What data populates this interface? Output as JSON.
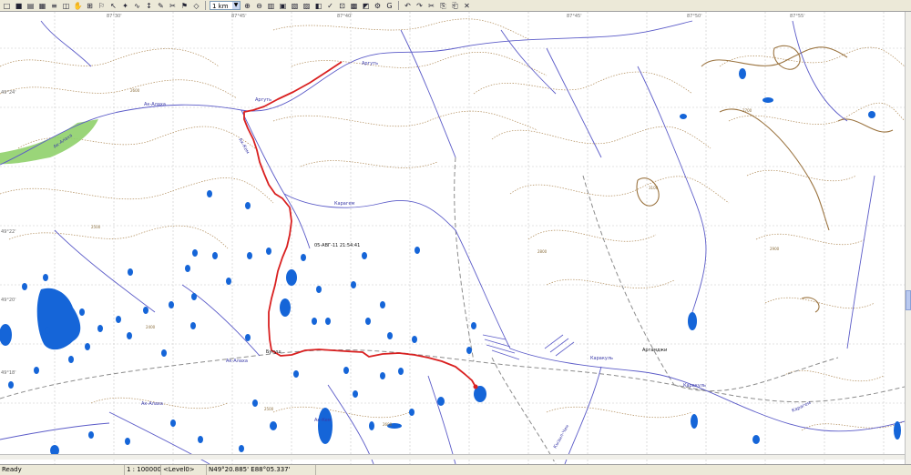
{
  "toolbar": {
    "scale_value": "1 km",
    "buttons": [
      {
        "name": "new-file-icon",
        "glyph": "□"
      },
      {
        "name": "save-icon",
        "glyph": "■"
      },
      {
        "name": "open-icon",
        "glyph": "▤"
      },
      {
        "name": "print-icon",
        "glyph": "▦"
      },
      {
        "name": "track-icon",
        "glyph": "≡"
      },
      {
        "name": "layers-icon",
        "glyph": "◫"
      },
      {
        "name": "hand-pan-icon",
        "glyph": "✋"
      },
      {
        "name": "grid-icon",
        "glyph": "⊞"
      },
      {
        "name": "waypoint-icon",
        "glyph": "⚐"
      },
      {
        "name": "pointer-icon",
        "glyph": "↖"
      },
      {
        "name": "node-icon",
        "glyph": "✦"
      },
      {
        "name": "route-icon",
        "glyph": "∿"
      },
      {
        "name": "measure-icon",
        "glyph": "↕"
      },
      {
        "name": "edit-track-icon",
        "glyph": "✎"
      },
      {
        "name": "split-icon",
        "glyph": "✂"
      },
      {
        "name": "flag-icon",
        "glyph": "⚑"
      },
      {
        "name": "vertex-icon",
        "glyph": "◇"
      }
    ],
    "buttons_after_scale": [
      {
        "name": "zoom-in-icon",
        "glyph": "⊕"
      },
      {
        "name": "zoom-out-icon",
        "glyph": "⊖"
      },
      {
        "name": "map-list-icon",
        "glyph": "▥"
      },
      {
        "name": "map-view-icon",
        "glyph": "▣"
      },
      {
        "name": "map-set-icon",
        "glyph": "▧"
      },
      {
        "name": "satellite-icon",
        "glyph": "▨"
      },
      {
        "name": "overlay-icon",
        "glyph": "◧"
      },
      {
        "name": "check-icon",
        "glyph": "✓"
      },
      {
        "name": "compare-icon",
        "glyph": "⊡"
      },
      {
        "name": "image-icon",
        "glyph": "▩"
      },
      {
        "name": "image-copy-icon",
        "glyph": "◩"
      },
      {
        "name": "settings-icon",
        "glyph": "⚙"
      },
      {
        "name": "google-icon",
        "glyph": "G"
      }
    ],
    "buttons_edit": [
      {
        "name": "undo-icon",
        "glyph": "↶"
      },
      {
        "name": "redo-icon",
        "glyph": "↷"
      },
      {
        "name": "cut-icon",
        "glyph": "✂"
      },
      {
        "name": "copy-icon",
        "glyph": "⎘"
      },
      {
        "name": "paste-icon",
        "glyph": "⎗"
      },
      {
        "name": "delete-icon",
        "glyph": "✕"
      }
    ]
  },
  "map": {
    "colors": {
      "background": "#ffffff",
      "lake": "#1565d8",
      "river": "#5b5bc8",
      "contour": "#b08b58",
      "track": "#d92020",
      "road": "#8c8c8c",
      "grid": "#c8c8c8",
      "forest": "#8fd06a"
    },
    "top_coords": [
      "87°30'",
      "87°45'",
      "87°40'",
      "87°45'",
      "87°50'",
      "87°55'"
    ],
    "left_coords": [
      "49°24'",
      "49°22'",
      "49°20'",
      "49°18'"
    ],
    "timestamp_label": "05-АВГ-11 21:54:41",
    "place_labels": [
      "Бугуш",
      "Аргамджи"
    ],
    "river_labels": [
      "Ак-Алаха",
      "Аргуть",
      "Ак-Алаха",
      "Ак-Кем",
      "Карагем",
      "Аргуть",
      "Ак-Алаха",
      "Ак-Алаха",
      "Каракуль",
      "Каракуль",
      "Кызыл-Чин",
      "Ак-Кем",
      "Карагем"
    ],
    "elevations": [
      "2600",
      "2500",
      "2400",
      "2700",
      "2800",
      "2900",
      "3100",
      "2600",
      "2500"
    ]
  },
  "status": {
    "ready": "Ready",
    "scale": "1 : 100000",
    "level": "<Level0>",
    "coords": "N49°20.885' E88°05.337'"
  }
}
